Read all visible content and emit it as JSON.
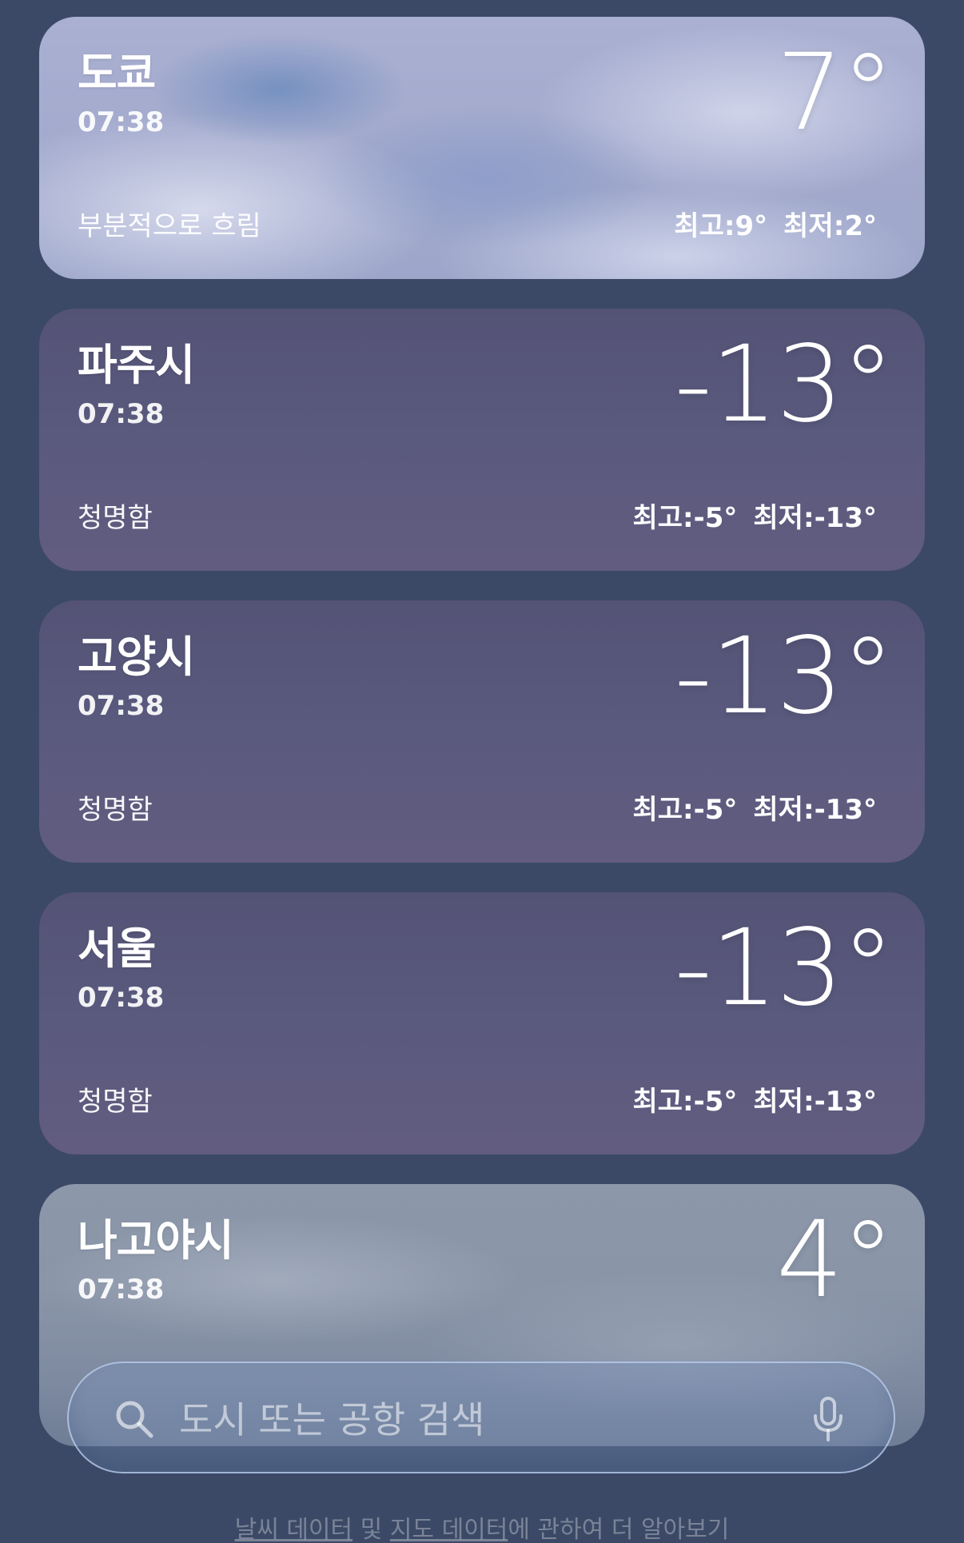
{
  "cities": [
    {
      "name": "도쿄",
      "time": "07:38",
      "temp": "7°",
      "condition": "부분적으로 흐림",
      "high": "최고:9°",
      "low": "최저:2°"
    },
    {
      "name": "파주시",
      "time": "07:38",
      "temp": "-13°",
      "condition": "청명함",
      "high": "최고:-5°",
      "low": "최저:-13°"
    },
    {
      "name": "고양시",
      "time": "07:38",
      "temp": "-13°",
      "condition": "청명함",
      "high": "최고:-5°",
      "low": "최저:-13°"
    },
    {
      "name": "서울",
      "time": "07:38",
      "temp": "-13°",
      "condition": "청명함",
      "high": "최고:-5°",
      "low": "최저:-13°"
    },
    {
      "name": "나고야시",
      "time": "07:38",
      "temp": "4°"
    }
  ],
  "search": {
    "placeholder": "도시 또는 공항 검색",
    "search_icon": "search-icon",
    "mic_icon": "microphone-icon"
  },
  "footer": {
    "link1": "날씨 데이터",
    "sep": " 및 ",
    "link2": "지도 데이터",
    "tail": "에 관하여 더 알아보기"
  },
  "colors": {
    "background": "#3b4966",
    "clear_card": "#5a5a7e"
  }
}
